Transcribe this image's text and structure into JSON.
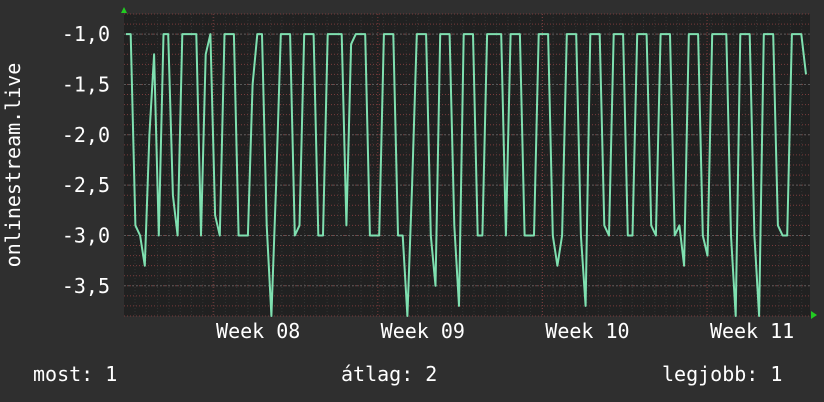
{
  "chart_data": {
    "type": "line",
    "ylabel": "onlinestream.live",
    "ylim": [
      -3.8,
      -0.8
    ],
    "y_ticks": [
      "-1,0",
      "-1,5",
      "-2,0",
      "-2,5",
      "-3,0",
      "-3,5"
    ],
    "y_tick_values": [
      -1.0,
      -1.5,
      -2.0,
      -2.5,
      -3.0,
      -3.5
    ],
    "x_ticks": [
      "Week 08",
      "Week 09",
      "Week 10",
      "Week 11"
    ],
    "x_tick_positions": [
      0.13,
      0.37,
      0.61,
      0.85
    ],
    "grid": true,
    "series": [
      {
        "color": "#7fe0b0",
        "values": [
          -1.0,
          -1.0,
          -2.9,
          -3.0,
          -3.3,
          -2.0,
          -1.2,
          -3.0,
          -1.0,
          -1.0,
          -2.6,
          -3.0,
          -1.0,
          -1.0,
          -1.0,
          -1.0,
          -3.0,
          -1.2,
          -1.0,
          -2.8,
          -3.0,
          -1.0,
          -1.0,
          -1.0,
          -3.0,
          -3.0,
          -3.0,
          -1.5,
          -1.0,
          -1.0,
          -2.9,
          -3.8,
          -2.5,
          -1.0,
          -1.0,
          -1.0,
          -3.0,
          -2.9,
          -1.0,
          -1.0,
          -1.0,
          -3.0,
          -3.0,
          -1.0,
          -1.0,
          -1.0,
          -1.0,
          -2.9,
          -1.1,
          -1.0,
          -1.0,
          -1.0,
          -3.0,
          -3.0,
          -3.0,
          -1.0,
          -1.0,
          -1.0,
          -3.0,
          -3.0,
          -3.8,
          -2.5,
          -1.0,
          -1.0,
          -1.0,
          -3.0,
          -3.5,
          -1.0,
          -1.0,
          -1.0,
          -2.9,
          -3.7,
          -1.0,
          -1.0,
          -1.0,
          -3.0,
          -3.0,
          -1.0,
          -1.0,
          -1.0,
          -1.0,
          -3.0,
          -1.0,
          -1.0,
          -1.0,
          -3.0,
          -3.0,
          -3.0,
          -1.0,
          -1.0,
          -1.0,
          -3.0,
          -3.3,
          -3.0,
          -1.0,
          -1.0,
          -1.0,
          -3.0,
          -3.7,
          -1.0,
          -1.0,
          -1.0,
          -2.9,
          -3.0,
          -1.0,
          -1.0,
          -1.0,
          -3.0,
          -3.0,
          -1.0,
          -1.0,
          -1.0,
          -2.9,
          -3.0,
          -1.0,
          -1.0,
          -1.0,
          -3.0,
          -2.9,
          -3.3,
          -1.0,
          -1.0,
          -1.0,
          -3.0,
          -3.2,
          -1.0,
          -1.0,
          -1.0,
          -1.0,
          -3.0,
          -3.8,
          -1.0,
          -1.0,
          -1.0,
          -3.0,
          -3.8,
          -1.0,
          -1.0,
          -1.0,
          -2.9,
          -3.0,
          -3.0,
          -1.0,
          -1.0,
          -1.0,
          -1.4
        ]
      }
    ]
  },
  "footer": {
    "most": "most: 1",
    "atlag": "átlag: 2",
    "legjobb": "legjobb: 1"
  },
  "colors": {
    "background": "#2f2f2f",
    "plot_background": "#212121",
    "grid_major": "#595959",
    "grid_minor_dotted": "#7a3b3b",
    "line": "#7fe0b0",
    "text": "#ffffff",
    "arrow": "#22cc22"
  }
}
